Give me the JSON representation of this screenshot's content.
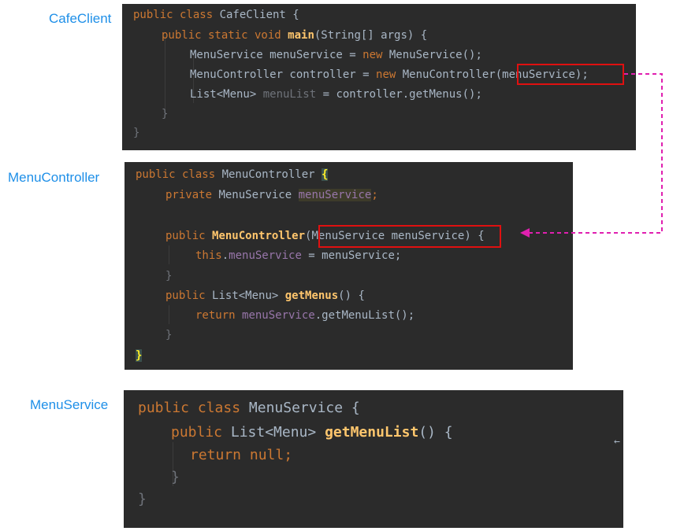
{
  "labels": {
    "cafe_client": "CafeClient",
    "menu_controller": "MenuController",
    "menu_service": "MenuService"
  },
  "code": {
    "cafe_client": {
      "l1": [
        "public class ",
        "CafeClient {"
      ],
      "l2": [
        "public static void ",
        "main",
        "(String[] args) {"
      ],
      "l3": [
        "MenuService menuService = ",
        "new ",
        "MenuService();"
      ],
      "l4": [
        "MenuController controller = ",
        "new ",
        "MenuController",
        "(menuService);"
      ],
      "l5": [
        "List<Menu> ",
        "menuList",
        " = controller.getMenus();"
      ],
      "l6": "}",
      "l7": "}"
    },
    "menu_controller": {
      "l1": [
        "public class ",
        "MenuController ",
        "{"
      ],
      "l2": [
        "private ",
        "MenuService ",
        "menuService",
        ";"
      ],
      "l3": [
        "public ",
        "MenuController",
        "(MenuService menuService) ",
        "{"
      ],
      "l4": [
        "this",
        ".",
        "menuService",
        " = menuService;"
      ],
      "l5": "}",
      "l6": [
        "public ",
        "List<Menu> ",
        "getMenus",
        "() {"
      ],
      "l7": [
        "return ",
        "menuService",
        ".getMenuList();"
      ],
      "l8": "}",
      "l9": "}"
    },
    "menu_service": {
      "l1": [
        "public class ",
        "MenuService {"
      ],
      "l2": [
        "public ",
        "List<Menu> ",
        "getMenuList",
        "() {"
      ],
      "l3": [
        "return null",
        ";"
      ],
      "l4": "}",
      "l5": "}"
    }
  },
  "colors": {
    "label_blue": "#1e8fe8",
    "panel_bg": "#2b2b2b",
    "keyword": "#cc7832",
    "method": "#ffc66d",
    "field": "#9876aa",
    "plain": "#a9b7c6",
    "highlight_box": "#e01010",
    "arrow": "#e020b0"
  },
  "connector": {
    "from": "CafeClient (menuService) argument",
    "to": "MenuController constructor parameter",
    "style": "dashed-arrow"
  },
  "cursor_glyph": "←"
}
